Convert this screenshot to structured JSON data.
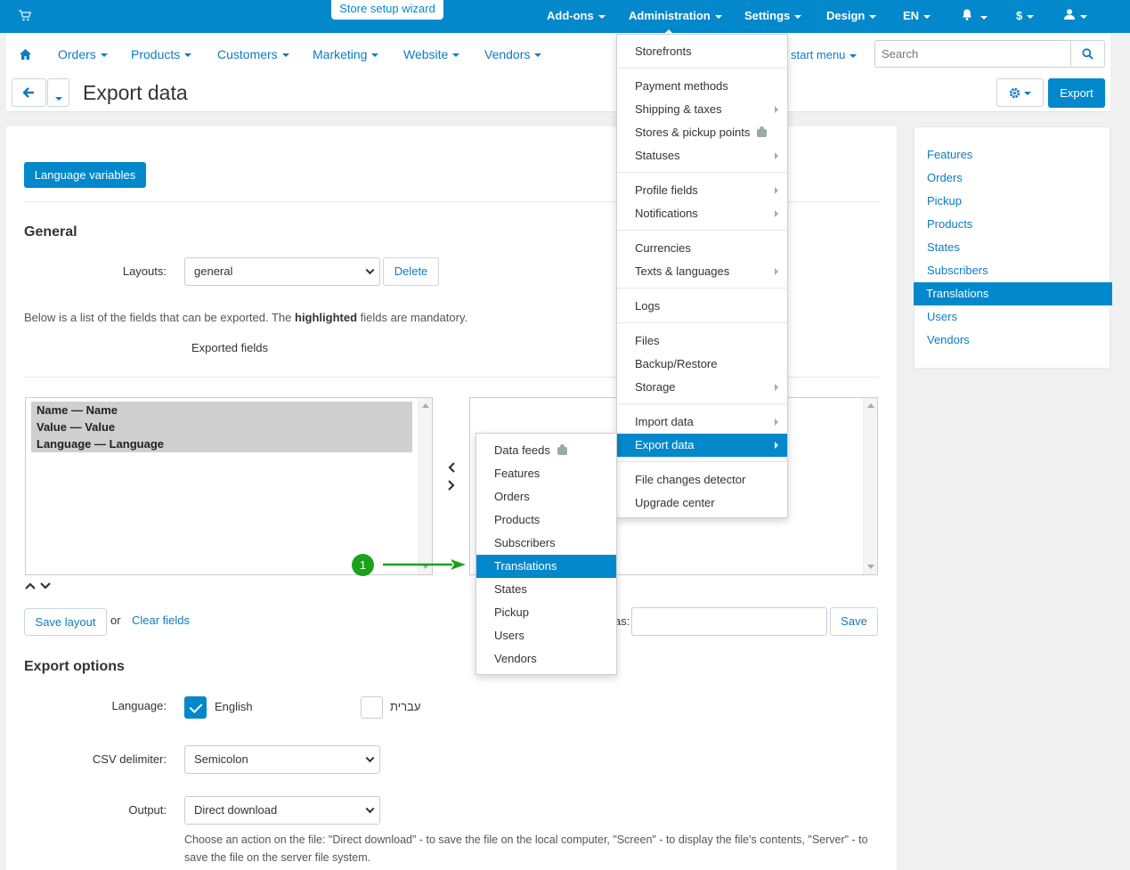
{
  "topbar": {
    "wizard": "Store setup wizard",
    "addons": "Add-ons",
    "administration": "Administration",
    "settings": "Settings",
    "design": "Design",
    "lang": "EN",
    "currency": "$"
  },
  "nav": {
    "items": [
      "Orders",
      "Products",
      "Customers",
      "Marketing",
      "Website",
      "Vendors"
    ],
    "start_menu": "start menu",
    "search_placeholder": "Search"
  },
  "page": {
    "title": "Export data",
    "export_btn": "Export"
  },
  "main": {
    "lang_vars_btn": "Language variables",
    "general_heading": "General",
    "layouts_label": "Layouts:",
    "layout_value": "general",
    "delete_btn": "Delete",
    "desc_pre": "Below is a list of the fields that can be exported. The ",
    "desc_bold": "highlighted",
    "desc_post": " fields are mandatory.",
    "exported_fields": "Exported fields",
    "fields": [
      "Name — Name",
      "Value — Value",
      "Language — Language"
    ],
    "save_layout": "Save layout",
    "or": "or",
    "clear_fields": "Clear fields",
    "save_as_label_visible": "as:",
    "save_btn": "Save",
    "export_options": "Export options",
    "language_label": "Language:",
    "lang_english": "English",
    "lang_hebrew": "עברית",
    "csv_label": "CSV delimiter:",
    "csv_value": "Semicolon",
    "output_label": "Output:",
    "output_value": "Direct download",
    "output_help": "Choose an action on the file: \"Direct download\" - to save the file on the local computer, \"Screen\" - to display the file's contents, \"Server\" - to save the file on the server file system."
  },
  "sidebar": {
    "items": [
      "Features",
      "Orders",
      "Pickup",
      "Products",
      "States",
      "Subscribers",
      "Translations",
      "Users",
      "Vendors"
    ],
    "active": "Translations"
  },
  "admin_menu": {
    "groups": [
      [
        "Storefronts"
      ],
      [
        "Payment methods",
        "Shipping & taxes",
        "Stores & pickup points",
        "Statuses"
      ],
      [
        "Profile fields",
        "Notifications"
      ],
      [
        "Currencies",
        "Texts & languages"
      ],
      [
        "Logs"
      ],
      [
        "Files",
        "Backup/Restore",
        "Storage"
      ],
      [
        "Import data",
        "Export data"
      ],
      [
        "File changes detector",
        "Upgrade center"
      ]
    ],
    "selected": "Export data"
  },
  "export_submenu": {
    "items": [
      "Data feeds",
      "Features",
      "Orders",
      "Products",
      "Subscribers",
      "Translations",
      "States",
      "Pickup",
      "Users",
      "Vendors"
    ],
    "selected": "Translations"
  },
  "annotation": {
    "step": "1"
  },
  "colors": {
    "brand": "#0388cc",
    "link": "#0e7bc2",
    "annotation": "#1aa31a"
  }
}
